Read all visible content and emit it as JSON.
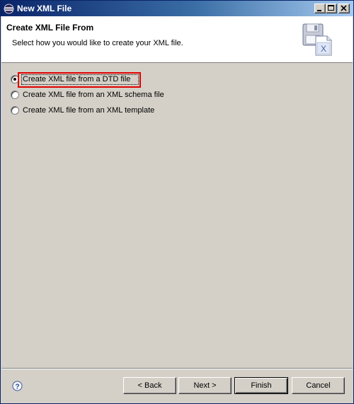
{
  "window": {
    "title": "New XML File"
  },
  "header": {
    "title": "Create XML File From",
    "description": "Select how you would like to create your XML file.",
    "icon": "xml-file-wizard-icon"
  },
  "options": [
    {
      "label": "Create XML file from a DTD file",
      "checked": true
    },
    {
      "label": "Create XML file from an XML schema file",
      "checked": false
    },
    {
      "label": "Create XML file from an XML template",
      "checked": false
    }
  ],
  "buttons": {
    "back": "< Back",
    "next": "Next >",
    "finish": "Finish",
    "cancel": "Cancel"
  },
  "colors": {
    "titlebar_start": "#0a246a",
    "titlebar_end": "#a6caf0",
    "dialog_bg": "#d4d0c8",
    "focus_highlight": "#e00000"
  }
}
